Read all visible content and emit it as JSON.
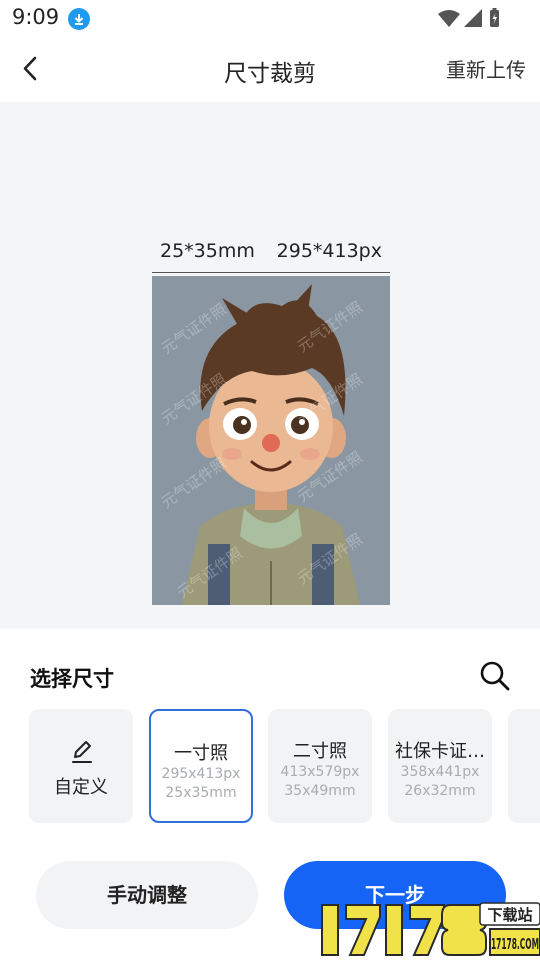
{
  "status_bar": {
    "time": "9:09"
  },
  "header": {
    "title": "尺寸裁剪",
    "reupload_label": "重新上传"
  },
  "preview": {
    "size_mm": "25*35mm",
    "size_px": "295*413px",
    "watermark_text": "元气证件照"
  },
  "size_picker": {
    "title": "选择尺寸",
    "custom_label": "自定义",
    "options": [
      {
        "name": "一寸照",
        "px": "295x413px",
        "mm": "25x35mm",
        "selected": true
      },
      {
        "name": "二寸照",
        "px": "413x579px",
        "mm": "35x49mm",
        "selected": false
      },
      {
        "name": "社保卡证…",
        "px": "358x441px",
        "mm": "26x32mm",
        "selected": false
      }
    ]
  },
  "actions": {
    "manual_label": "手动调整",
    "next_label": "下一步"
  },
  "overlay_logo": {
    "text": "17178.COM",
    "badge": "下载站"
  },
  "colors": {
    "accent": "#1564f6",
    "selected_border": "#2f6fe0",
    "preview_bg": "#f4f5f7"
  }
}
